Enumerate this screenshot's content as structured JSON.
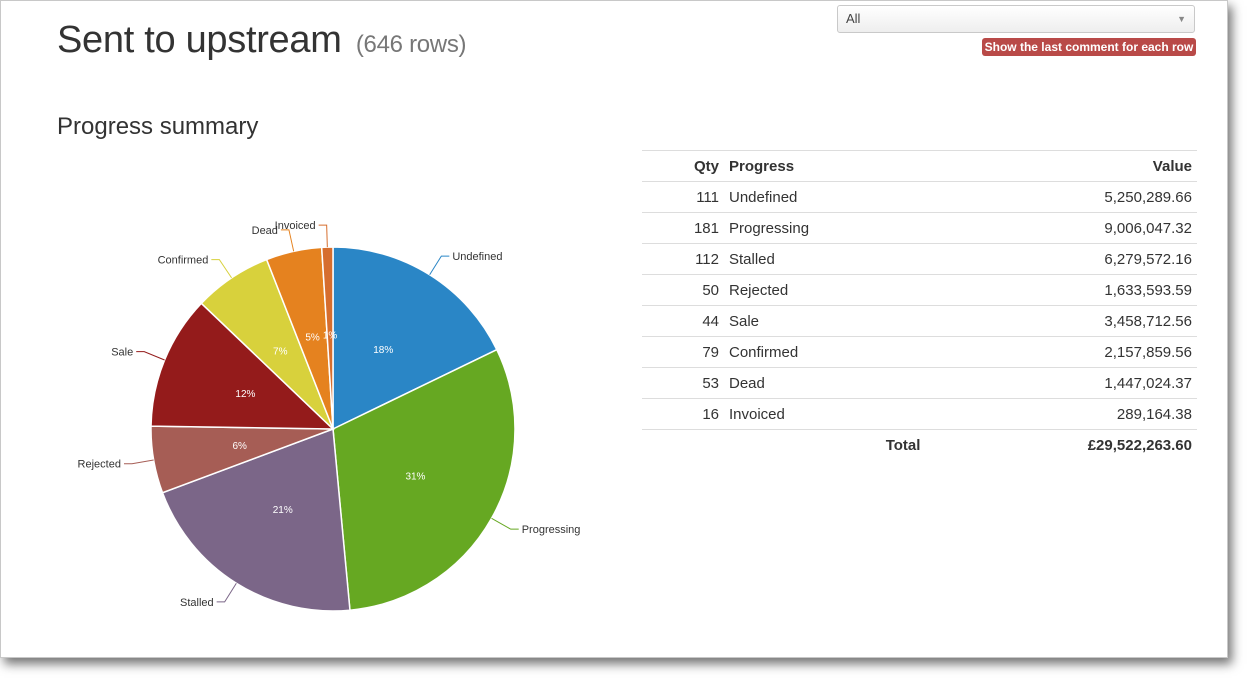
{
  "header": {
    "title": "Sent to upstream",
    "row_count": "(646 rows)",
    "filter_value": "All",
    "last_comment_button": "Show the last comment for each row"
  },
  "section_title": "Progress summary",
  "table": {
    "headers": {
      "qty": "Qty",
      "progress": "Progress",
      "value": "Value"
    },
    "rows": [
      {
        "qty": "111",
        "progress": "Undefined",
        "value": "5,250,289.66"
      },
      {
        "qty": "181",
        "progress": "Progressing",
        "value": "9,006,047.32"
      },
      {
        "qty": "112",
        "progress": "Stalled",
        "value": "6,279,572.16"
      },
      {
        "qty": "50",
        "progress": "Rejected",
        "value": "1,633,593.59"
      },
      {
        "qty": "44",
        "progress": "Sale",
        "value": "3,458,712.56"
      },
      {
        "qty": "79",
        "progress": "Confirmed",
        "value": "2,157,859.56"
      },
      {
        "qty": "53",
        "progress": "Dead",
        "value": "1,447,024.37"
      },
      {
        "qty": "16",
        "progress": "Invoiced",
        "value": "289,164.38"
      }
    ],
    "total_label": "Total",
    "total_value": "£29,522,263.60"
  },
  "chart_data": {
    "type": "pie",
    "title": "",
    "categories": [
      "Undefined",
      "Progressing",
      "Stalled",
      "Rejected",
      "Sale",
      "Confirmed",
      "Dead",
      "Invoiced"
    ],
    "values": [
      18,
      31,
      21,
      6,
      12,
      7,
      5,
      1
    ],
    "labels": [
      "18%",
      "31%",
      "21%",
      "6%",
      "12%",
      "7%",
      "5%",
      "1%"
    ],
    "colors": [
      "#2a86c6",
      "#66a822",
      "#7b6688",
      "#a65d55",
      "#941b1b",
      "#d8d13c",
      "#e5821f",
      "#d66e2e"
    ]
  }
}
